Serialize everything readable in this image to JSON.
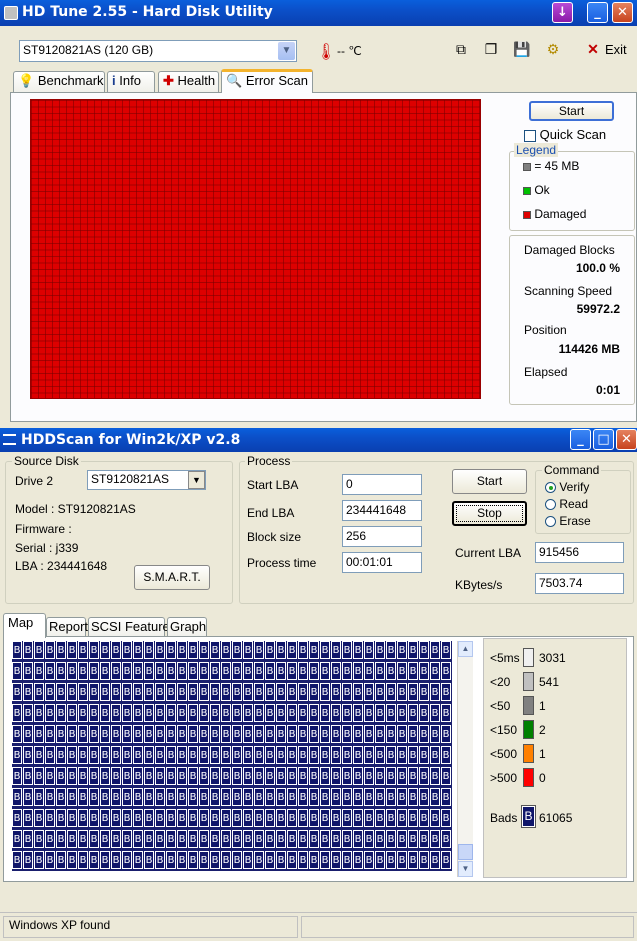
{
  "hdtune": {
    "title": "HD Tune 2.55 - Hard Disk Utility",
    "drive_select": "ST9120821AS (120 GB)",
    "temperature": "-- ℃",
    "exit_label": "Exit",
    "tabs": [
      {
        "label": "Benchmark"
      },
      {
        "label": "Info"
      },
      {
        "label": "Health"
      },
      {
        "label": "Error Scan"
      }
    ],
    "start_label": "Start",
    "quick_scan_label": "Quick Scan",
    "legend_title": "Legend",
    "legend": [
      {
        "label": "= 45 MB",
        "color": "#808080"
      },
      {
        "label": "Ok",
        "color": "#00c000"
      },
      {
        "label": "Damaged",
        "color": "#dd0000"
      }
    ],
    "stats": [
      {
        "label": "Damaged Blocks",
        "value": "100.0 %"
      },
      {
        "label": "Scanning Speed",
        "value": "59972.2"
      },
      {
        "label": "Position",
        "value": "114426 MB"
      },
      {
        "label": "Elapsed",
        "value": "0:01"
      }
    ],
    "damaged_color": "#dd0000"
  },
  "hddscan": {
    "title": "HDDScan for Win2k/XP  v2.8",
    "source_disk_title": "Source Disk",
    "drive_label": "Drive  2",
    "drive_select": "ST9120821AS",
    "model": "Model : ST9120821AS",
    "firmware": "Firmware :",
    "serial": "Serial : j339",
    "lba": "LBA :  234441648",
    "smart_label": "S.M.A.R.T.",
    "process_title": "Process",
    "start_lba_label": "Start LBA",
    "start_lba": "0",
    "end_lba_label": "End LBA",
    "end_lba": "234441648",
    "block_size_label": "Block size",
    "block_size": "256",
    "process_time_label": "Process time",
    "process_time": "00:01:01",
    "start_label": "Start",
    "stop_label": "Stop",
    "command_title": "Command",
    "commands": [
      {
        "label": "Verify",
        "selected": true
      },
      {
        "label": "Read",
        "selected": false
      },
      {
        "label": "Erase",
        "selected": false
      }
    ],
    "current_lba_label": "Current LBA",
    "current_lba": "915456",
    "kbytes_label": "KBytes/s",
    "kbytes": "7503.74",
    "tabs": [
      {
        "label": "Map"
      },
      {
        "label": "Report"
      },
      {
        "label": "SCSI Features"
      },
      {
        "label": "Graph"
      }
    ],
    "block_char": "B",
    "legend": [
      {
        "label": "<5ms",
        "value": "3031",
        "color": "#f0f0f0"
      },
      {
        "label": "<20",
        "value": "541",
        "color": "#c0c0c0"
      },
      {
        "label": "<50",
        "value": "1",
        "color": "#808080"
      },
      {
        "label": "<150",
        "value": "2",
        "color": "#008000"
      },
      {
        "label": "<500",
        "value": "1",
        "color": "#ff8000"
      },
      {
        "label": ">500",
        "value": "0",
        "color": "#ff0000"
      }
    ],
    "bads_label": "Bads",
    "bads_value": "61065",
    "status": "Windows XP found"
  }
}
